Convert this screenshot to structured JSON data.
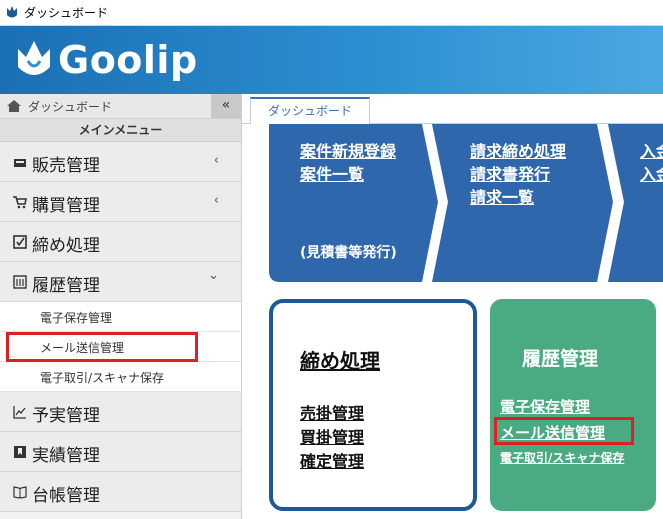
{
  "window": {
    "title": "ダッシュボード"
  },
  "header": {
    "logo_text": "Goolip",
    "colors": {
      "start": "#1c6fb4",
      "end": "#4aa8e0"
    }
  },
  "sidebar": {
    "home_label": "ダッシュボード",
    "collapse_icon": "«",
    "heading": "メインメニュー",
    "items": [
      {
        "label": "販売管理",
        "icon": "register-icon",
        "chevron": "‹"
      },
      {
        "label": "購買管理",
        "icon": "cart-icon",
        "chevron": "‹"
      },
      {
        "label": "締め処理",
        "icon": "checkbox-icon",
        "chevron": ""
      },
      {
        "label": "履歴管理",
        "icon": "history-icon",
        "chevron": "⌄"
      }
    ],
    "subitems": [
      {
        "label": "電子保存管理"
      },
      {
        "label": "メール送信管理"
      },
      {
        "label": "電子取引/スキャナ保存"
      }
    ],
    "items_after": [
      {
        "label": "予実管理",
        "icon": "chart-icon"
      },
      {
        "label": "実績管理",
        "icon": "bookmark-icon"
      },
      {
        "label": "台帳管理",
        "icon": "book-icon"
      }
    ]
  },
  "tabs": [
    {
      "label": "ダッシュボード"
    }
  ],
  "flow": {
    "step1": {
      "links": [
        "案件新規登録",
        "案件一覧"
      ],
      "note": "(見積書等発行)"
    },
    "step2": {
      "links": [
        "請求締め処理",
        "請求書発行",
        "請求一覧"
      ]
    },
    "step3": {
      "links": [
        "入金",
        "入金"
      ]
    }
  },
  "cards": {
    "closing": {
      "title": "締め処理",
      "links": [
        "売掛管理",
        "買掛管理",
        "確定管理"
      ]
    },
    "history": {
      "title": "履歴管理",
      "links": [
        "電子保存管理",
        "メール送信管理",
        "電子取引/スキャナ保存"
      ]
    }
  },
  "colors": {
    "flow_blue": "#2f67ad",
    "card_border": "#1c5a97",
    "card_green": "#4aab82",
    "highlight": "#e02020"
  }
}
